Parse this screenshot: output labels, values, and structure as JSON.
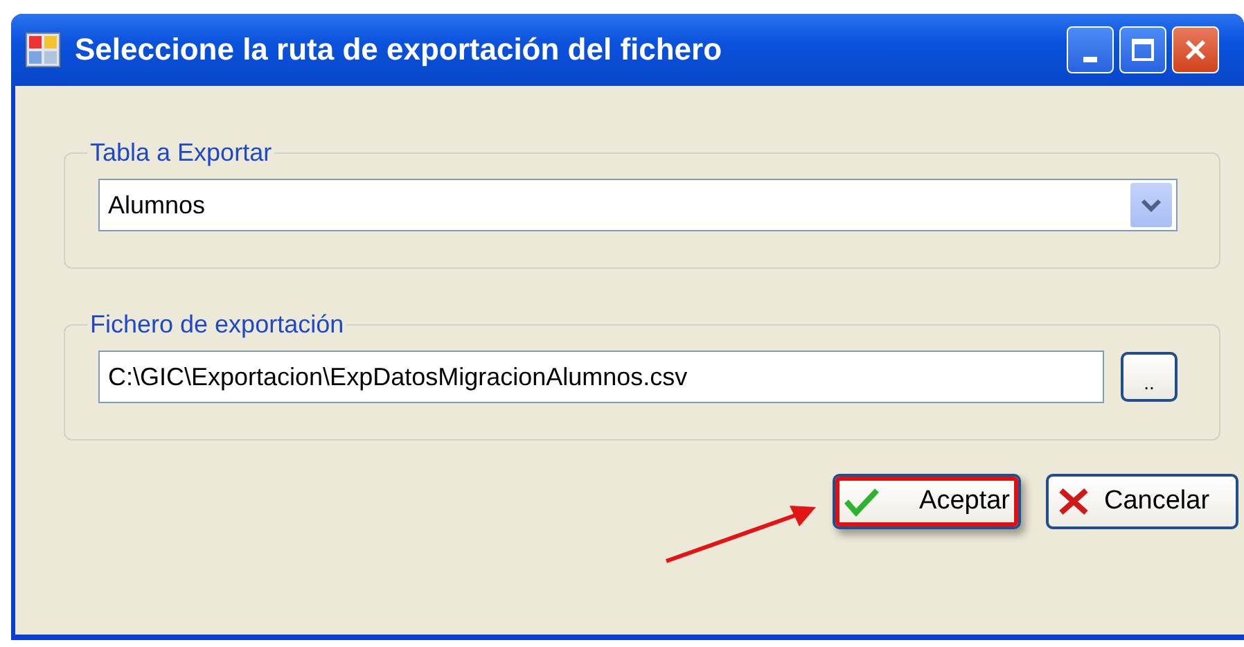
{
  "window": {
    "title": "Seleccione la ruta de exportación del fichero"
  },
  "table_group": {
    "legend": "Tabla a Exportar",
    "value": "Alumnos"
  },
  "file_group": {
    "legend": "Fichero de exportación",
    "value": "C:\\GIC\\Exportacion\\ExpDatosMigracionAlumnos.csv",
    "browse_label": ".."
  },
  "buttons": [
    {
      "kind": "ok",
      "label": "Aceptar",
      "highlighted": true
    },
    {
      "kind": "cancel",
      "label": "Cancelar",
      "highlighted": false
    }
  ]
}
